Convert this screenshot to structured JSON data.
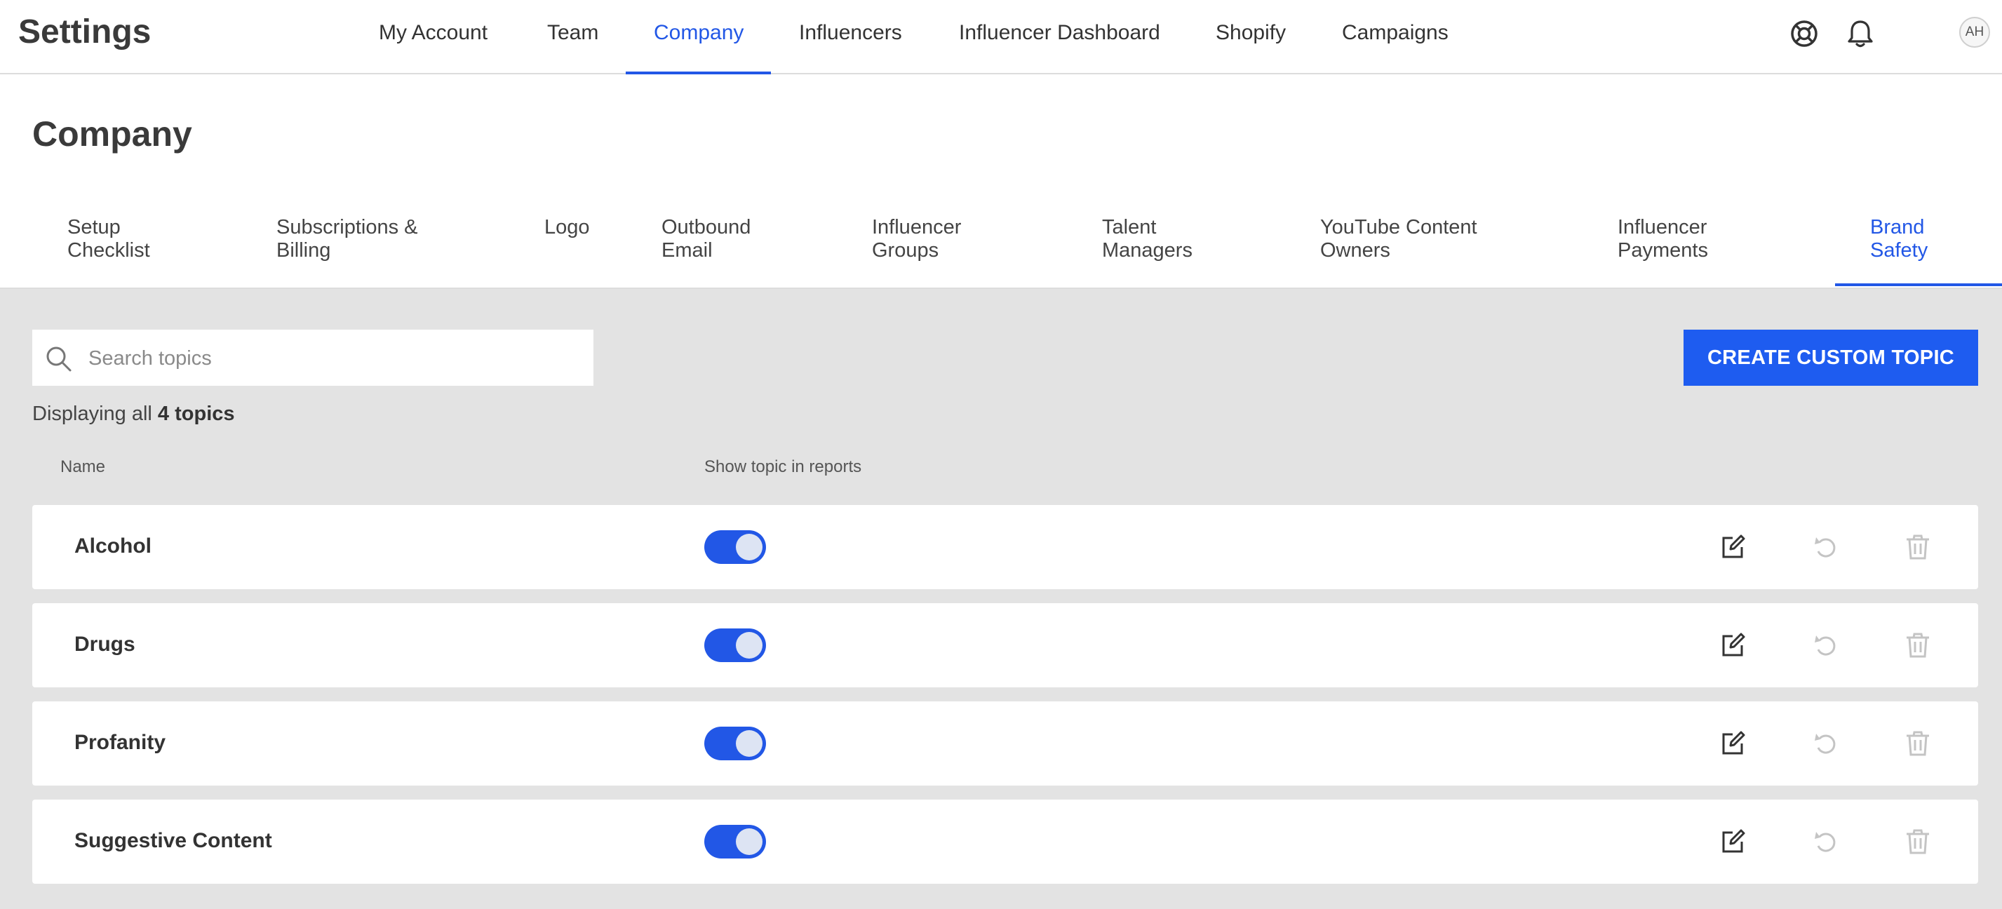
{
  "app": {
    "title": "Settings"
  },
  "topnav": {
    "items": [
      {
        "label": "My Account"
      },
      {
        "label": "Team"
      },
      {
        "label": "Company"
      },
      {
        "label": "Influencers"
      },
      {
        "label": "Influencer Dashboard"
      },
      {
        "label": "Shopify"
      },
      {
        "label": "Campaigns"
      }
    ],
    "active": "Company",
    "icons": [
      "help-lifebuoy-icon",
      "notification-bell-icon"
    ],
    "avatar_initials": "AH"
  },
  "page": {
    "title": "Company"
  },
  "subtabs": {
    "items": [
      {
        "line1": "Setup",
        "line2": "Checklist"
      },
      {
        "line1": "Subscriptions &",
        "line2": "Billing"
      },
      {
        "line1": "Logo",
        "line2": ""
      },
      {
        "line1": "Outbound",
        "line2": "Email"
      },
      {
        "line1": "Influencer",
        "line2": "Groups"
      },
      {
        "line1": "Talent",
        "line2": "Managers"
      },
      {
        "line1": "YouTube Content",
        "line2": "Owners"
      },
      {
        "line1": "Influencer",
        "line2": "Payments"
      },
      {
        "line1": "Brand",
        "line2": "Safety"
      }
    ],
    "active": "Brand Safety"
  },
  "search": {
    "placeholder": "Search topics",
    "value": ""
  },
  "create_button": {
    "label": "CREATE CUSTOM TOPIC"
  },
  "summary": {
    "prefix": "Displaying all",
    "count_text": "4 topics"
  },
  "table": {
    "columns": [
      "Name",
      "Show topic in reports"
    ],
    "rows": [
      {
        "name": "Alcohol",
        "show_in_reports": true
      },
      {
        "name": "Drugs",
        "show_in_reports": true
      },
      {
        "name": "Profanity",
        "show_in_reports": true
      },
      {
        "name": "Suggestive Content",
        "show_in_reports": true
      }
    ],
    "row_actions": [
      "edit-icon",
      "restore-icon",
      "delete-icon"
    ]
  },
  "colors": {
    "accent": "#2257e6",
    "button": "#1e5cf0",
    "content_bg": "#e3e3e3",
    "disabled_icon": "#c4c4c4"
  }
}
